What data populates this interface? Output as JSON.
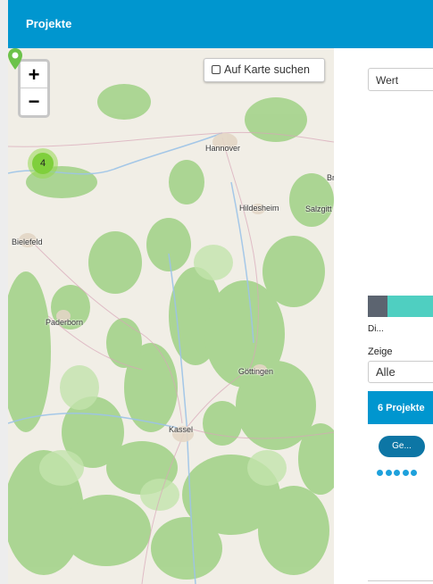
{
  "header": {
    "title": "Projekte"
  },
  "map": {
    "zoom_in_label": "+",
    "zoom_out_label": "−",
    "search_label": "Auf Karte suchen",
    "cluster_count": "4",
    "cities": {
      "hannover": "Hannover",
      "hildesheim": "Hildesheim",
      "salzgitter": "Salzgitt",
      "bielefeld": "Bielefeld",
      "paderborn": "Paderborn",
      "goettingen": "Göttingen",
      "kassel": "Kassel",
      "braunschweig_partial": "Br"
    },
    "colors": {
      "forest": "#a8d48f",
      "base": "#f1eee6",
      "water": "#9cc3e8"
    }
  },
  "sidebar": {
    "value_select": "Wert",
    "bar_label": "Di...",
    "show_label": "Zeige",
    "show_select": "Alle",
    "projects_header": "6 Projekte",
    "project_button": "Ge...",
    "bar_colors": [
      "#5c6470",
      "#4fcfc1"
    ],
    "pagination_dots": 5
  }
}
